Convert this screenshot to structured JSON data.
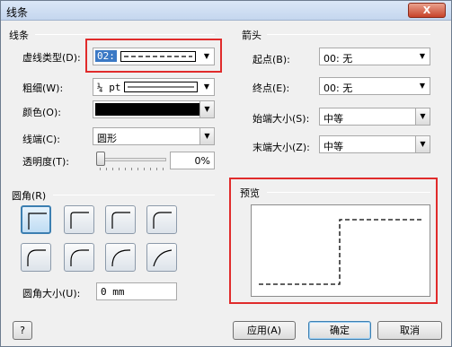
{
  "window": {
    "title": "线条",
    "close_label": "X"
  },
  "line_section": {
    "title": "线条",
    "dash_type_label": "虚线类型(D):",
    "dash_type_value": "02:",
    "weight_label": "粗细(W):",
    "weight_value": "¼ pt",
    "color_label": "颜色(O):",
    "color_value": "#000000",
    "cap_label": "线端(C):",
    "cap_value": "圆形",
    "transparency_label": "透明度(T):",
    "transparency_value": "0%",
    "transparency_level": 0
  },
  "arrow_section": {
    "title": "箭头",
    "begin_label": "起点(B):",
    "begin_value": "00: 无",
    "end_label": "终点(E):",
    "end_value": "00: 无",
    "begin_size_label": "始端大小(S):",
    "begin_size_value": "中等",
    "end_size_label": "末端大小(Z):",
    "end_size_value": "中等"
  },
  "corner_section": {
    "title": "圆角(R)",
    "size_label": "圆角大小(U):",
    "size_value": "0 mm"
  },
  "preview_section": {
    "title": "预览"
  },
  "footer": {
    "help_icon_label": "?",
    "apply_label": "应用(A)",
    "ok_label": "确定",
    "cancel_label": "取消"
  },
  "colors": {
    "highlight": "#e02b2b",
    "accent": "#3c7fb1"
  }
}
